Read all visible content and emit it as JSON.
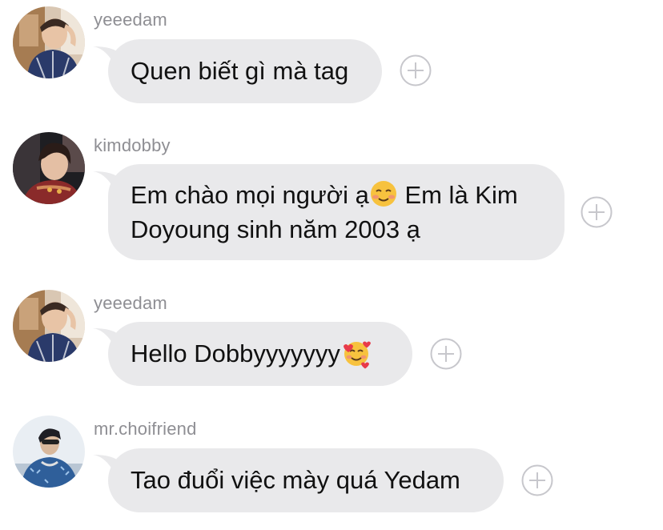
{
  "messages": [
    {
      "username": "yeeedam",
      "text": "Quen biết gì mà tag",
      "avatar": "avatar-photo-icon"
    },
    {
      "username": "kimdobby",
      "text_line1": "Em chào mọi người ạ",
      "text_line1_after_emoji": " Em là Kim",
      "text_line2": "Doyoung sinh năm 2003 ạ",
      "emoji": "smiling-face-emoji",
      "avatar": "avatar-photo-icon"
    },
    {
      "username": "yeeedam",
      "text": "Hello Dobbyyyyyyy",
      "emoji": "smiling-face-with-hearts-emoji",
      "avatar": "avatar-photo-icon"
    },
    {
      "username": "mr.choifriend",
      "text": "Tao đuổi việc mày quá Yedam",
      "avatar": "avatar-photo-icon"
    }
  ],
  "colors": {
    "bubble": "#e9e9eb",
    "username": "#8e8e93",
    "text": "#111111",
    "plus_icon": "#c7c7cc"
  }
}
